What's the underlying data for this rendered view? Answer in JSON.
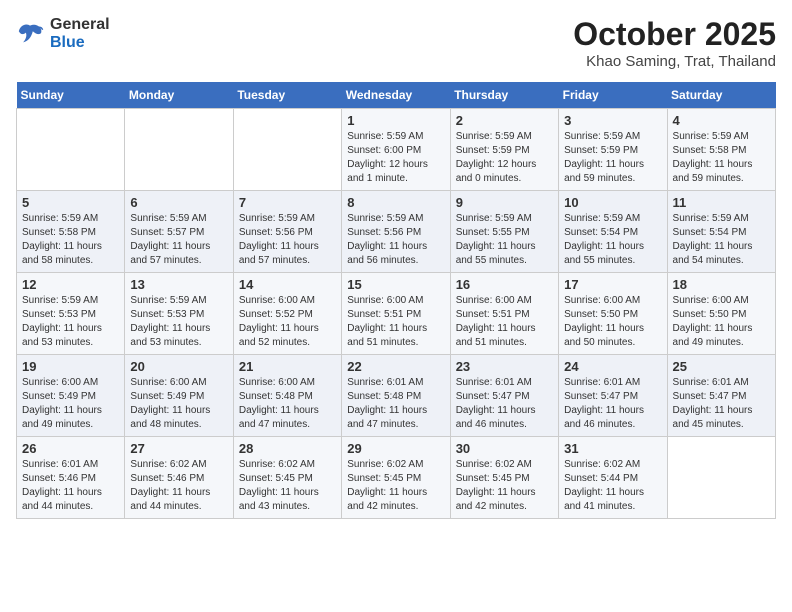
{
  "logo": {
    "general": "General",
    "blue": "Blue"
  },
  "header": {
    "month": "October 2025",
    "location": "Khao Saming, Trat, Thailand"
  },
  "days_of_week": [
    "Sunday",
    "Monday",
    "Tuesday",
    "Wednesday",
    "Thursday",
    "Friday",
    "Saturday"
  ],
  "weeks": [
    [
      {
        "day": "",
        "sunrise": "",
        "sunset": "",
        "daylight": ""
      },
      {
        "day": "",
        "sunrise": "",
        "sunset": "",
        "daylight": ""
      },
      {
        "day": "",
        "sunrise": "",
        "sunset": "",
        "daylight": ""
      },
      {
        "day": "1",
        "sunrise": "Sunrise: 5:59 AM",
        "sunset": "Sunset: 6:00 PM",
        "daylight": "Daylight: 12 hours and 1 minute."
      },
      {
        "day": "2",
        "sunrise": "Sunrise: 5:59 AM",
        "sunset": "Sunset: 5:59 PM",
        "daylight": "Daylight: 12 hours and 0 minutes."
      },
      {
        "day": "3",
        "sunrise": "Sunrise: 5:59 AM",
        "sunset": "Sunset: 5:59 PM",
        "daylight": "Daylight: 11 hours and 59 minutes."
      },
      {
        "day": "4",
        "sunrise": "Sunrise: 5:59 AM",
        "sunset": "Sunset: 5:58 PM",
        "daylight": "Daylight: 11 hours and 59 minutes."
      }
    ],
    [
      {
        "day": "5",
        "sunrise": "Sunrise: 5:59 AM",
        "sunset": "Sunset: 5:58 PM",
        "daylight": "Daylight: 11 hours and 58 minutes."
      },
      {
        "day": "6",
        "sunrise": "Sunrise: 5:59 AM",
        "sunset": "Sunset: 5:57 PM",
        "daylight": "Daylight: 11 hours and 57 minutes."
      },
      {
        "day": "7",
        "sunrise": "Sunrise: 5:59 AM",
        "sunset": "Sunset: 5:56 PM",
        "daylight": "Daylight: 11 hours and 57 minutes."
      },
      {
        "day": "8",
        "sunrise": "Sunrise: 5:59 AM",
        "sunset": "Sunset: 5:56 PM",
        "daylight": "Daylight: 11 hours and 56 minutes."
      },
      {
        "day": "9",
        "sunrise": "Sunrise: 5:59 AM",
        "sunset": "Sunset: 5:55 PM",
        "daylight": "Daylight: 11 hours and 55 minutes."
      },
      {
        "day": "10",
        "sunrise": "Sunrise: 5:59 AM",
        "sunset": "Sunset: 5:54 PM",
        "daylight": "Daylight: 11 hours and 55 minutes."
      },
      {
        "day": "11",
        "sunrise": "Sunrise: 5:59 AM",
        "sunset": "Sunset: 5:54 PM",
        "daylight": "Daylight: 11 hours and 54 minutes."
      }
    ],
    [
      {
        "day": "12",
        "sunrise": "Sunrise: 5:59 AM",
        "sunset": "Sunset: 5:53 PM",
        "daylight": "Daylight: 11 hours and 53 minutes."
      },
      {
        "day": "13",
        "sunrise": "Sunrise: 5:59 AM",
        "sunset": "Sunset: 5:53 PM",
        "daylight": "Daylight: 11 hours and 53 minutes."
      },
      {
        "day": "14",
        "sunrise": "Sunrise: 6:00 AM",
        "sunset": "Sunset: 5:52 PM",
        "daylight": "Daylight: 11 hours and 52 minutes."
      },
      {
        "day": "15",
        "sunrise": "Sunrise: 6:00 AM",
        "sunset": "Sunset: 5:51 PM",
        "daylight": "Daylight: 11 hours and 51 minutes."
      },
      {
        "day": "16",
        "sunrise": "Sunrise: 6:00 AM",
        "sunset": "Sunset: 5:51 PM",
        "daylight": "Daylight: 11 hours and 51 minutes."
      },
      {
        "day": "17",
        "sunrise": "Sunrise: 6:00 AM",
        "sunset": "Sunset: 5:50 PM",
        "daylight": "Daylight: 11 hours and 50 minutes."
      },
      {
        "day": "18",
        "sunrise": "Sunrise: 6:00 AM",
        "sunset": "Sunset: 5:50 PM",
        "daylight": "Daylight: 11 hours and 49 minutes."
      }
    ],
    [
      {
        "day": "19",
        "sunrise": "Sunrise: 6:00 AM",
        "sunset": "Sunset: 5:49 PM",
        "daylight": "Daylight: 11 hours and 49 minutes."
      },
      {
        "day": "20",
        "sunrise": "Sunrise: 6:00 AM",
        "sunset": "Sunset: 5:49 PM",
        "daylight": "Daylight: 11 hours and 48 minutes."
      },
      {
        "day": "21",
        "sunrise": "Sunrise: 6:00 AM",
        "sunset": "Sunset: 5:48 PM",
        "daylight": "Daylight: 11 hours and 47 minutes."
      },
      {
        "day": "22",
        "sunrise": "Sunrise: 6:01 AM",
        "sunset": "Sunset: 5:48 PM",
        "daylight": "Daylight: 11 hours and 47 minutes."
      },
      {
        "day": "23",
        "sunrise": "Sunrise: 6:01 AM",
        "sunset": "Sunset: 5:47 PM",
        "daylight": "Daylight: 11 hours and 46 minutes."
      },
      {
        "day": "24",
        "sunrise": "Sunrise: 6:01 AM",
        "sunset": "Sunset: 5:47 PM",
        "daylight": "Daylight: 11 hours and 46 minutes."
      },
      {
        "day": "25",
        "sunrise": "Sunrise: 6:01 AM",
        "sunset": "Sunset: 5:47 PM",
        "daylight": "Daylight: 11 hours and 45 minutes."
      }
    ],
    [
      {
        "day": "26",
        "sunrise": "Sunrise: 6:01 AM",
        "sunset": "Sunset: 5:46 PM",
        "daylight": "Daylight: 11 hours and 44 minutes."
      },
      {
        "day": "27",
        "sunrise": "Sunrise: 6:02 AM",
        "sunset": "Sunset: 5:46 PM",
        "daylight": "Daylight: 11 hours and 44 minutes."
      },
      {
        "day": "28",
        "sunrise": "Sunrise: 6:02 AM",
        "sunset": "Sunset: 5:45 PM",
        "daylight": "Daylight: 11 hours and 43 minutes."
      },
      {
        "day": "29",
        "sunrise": "Sunrise: 6:02 AM",
        "sunset": "Sunset: 5:45 PM",
        "daylight": "Daylight: 11 hours and 42 minutes."
      },
      {
        "day": "30",
        "sunrise": "Sunrise: 6:02 AM",
        "sunset": "Sunset: 5:45 PM",
        "daylight": "Daylight: 11 hours and 42 minutes."
      },
      {
        "day": "31",
        "sunrise": "Sunrise: 6:02 AM",
        "sunset": "Sunset: 5:44 PM",
        "daylight": "Daylight: 11 hours and 41 minutes."
      },
      {
        "day": "",
        "sunrise": "",
        "sunset": "",
        "daylight": ""
      }
    ]
  ]
}
